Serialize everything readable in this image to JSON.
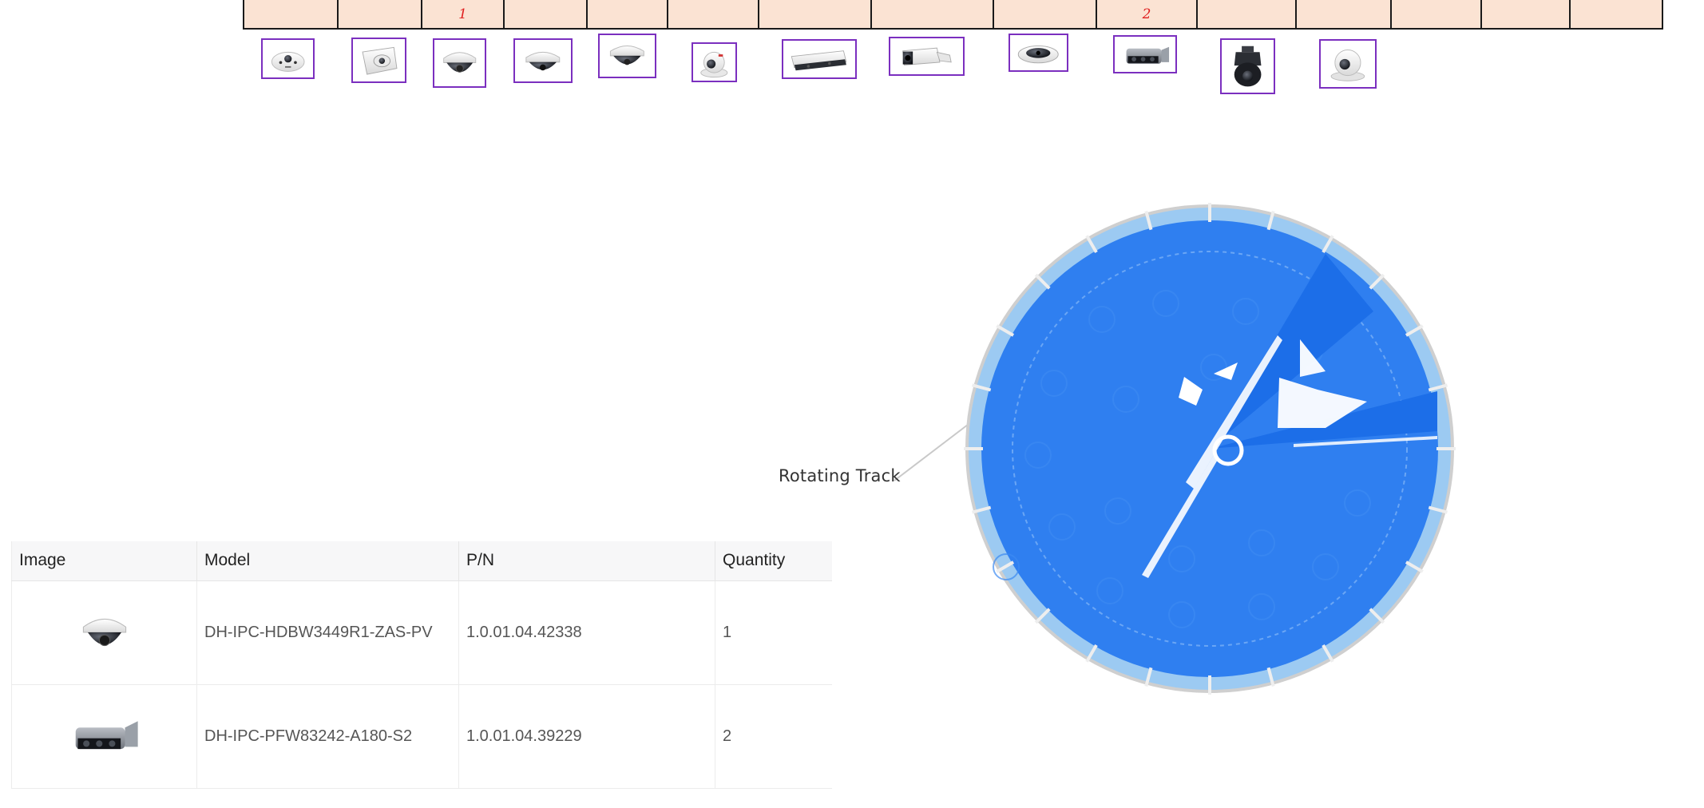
{
  "count_strip": {
    "cells": [
      "",
      "",
      "1",
      "",
      "",
      "",
      "",
      "",
      "",
      "2",
      "",
      "",
      "",
      "",
      ""
    ]
  },
  "thumbnails": [
    {
      "icon": "fisheye-dome-camera-icon"
    },
    {
      "icon": "corner-dome-camera-icon"
    },
    {
      "icon": "dome-camera-icon"
    },
    {
      "icon": "dome-camera-icon"
    },
    {
      "icon": "dome-camera-icon"
    },
    {
      "icon": "turret-camera-icon"
    },
    {
      "icon": "box-camera-icon"
    },
    {
      "icon": "bullet-camera-icon"
    },
    {
      "icon": "fisheye-camera-icon"
    },
    {
      "icon": "multi-sensor-camera-icon"
    },
    {
      "icon": "ptz-camera-icon"
    },
    {
      "icon": "turret-camera-icon"
    }
  ],
  "diagram": {
    "label": "Rotating Track",
    "colors": {
      "coverage": "#2f7ff0",
      "rim": "#9ccaf2",
      "outline": "#cfcfcf"
    }
  },
  "table": {
    "headers": [
      "Image",
      "Model",
      "P/N",
      "Quantity"
    ],
    "rows": [
      {
        "icon": "dome-camera-icon",
        "model": "DH-IPC-HDBW3449R1-ZAS-PV",
        "pn": "1.0.01.04.42338",
        "quantity": "1"
      },
      {
        "icon": "multi-sensor-camera-icon",
        "model": "DH-IPC-PFW83242-A180-S2",
        "pn": "1.0.01.04.39229",
        "quantity": "2"
      }
    ]
  }
}
